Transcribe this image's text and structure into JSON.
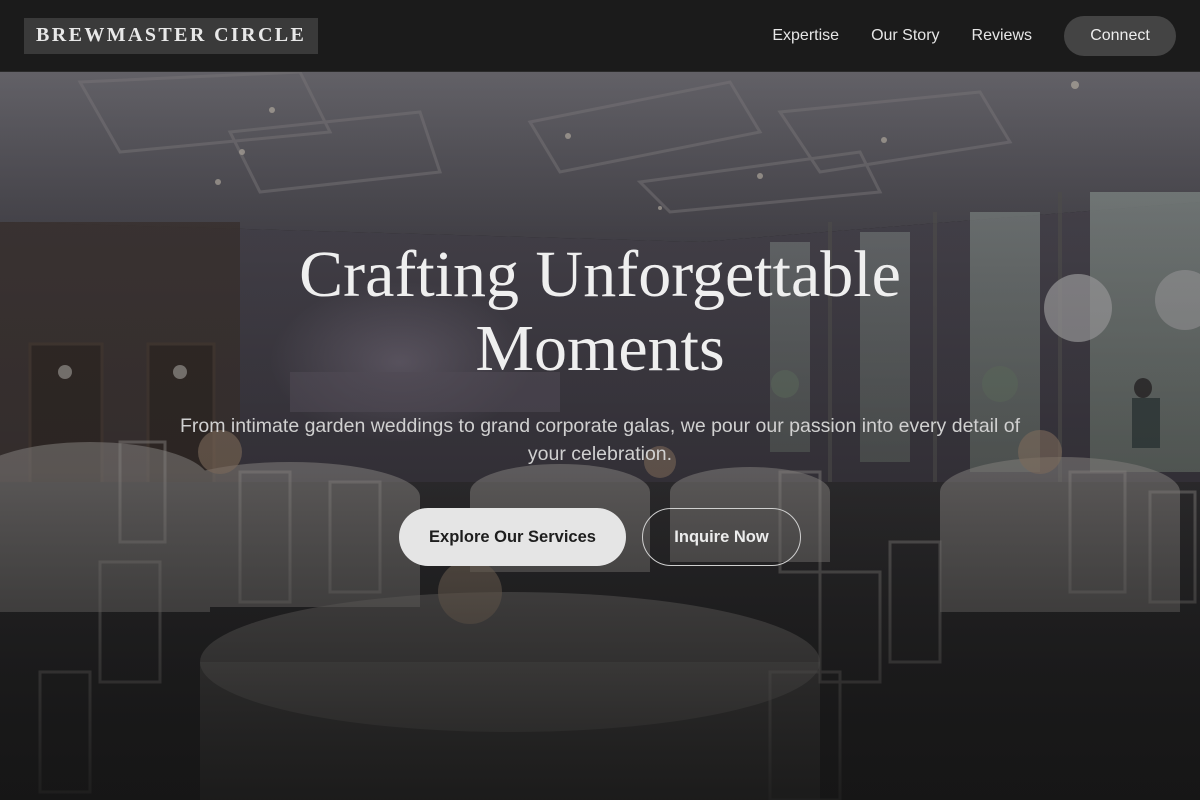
{
  "nav": {
    "logo_text": "BREWMASTER CIRCLE",
    "links": [
      "Expertise",
      "Our Story",
      "Reviews"
    ],
    "cta_label": "Connect"
  },
  "hero": {
    "title": "Crafting Unforgettable Moments",
    "subtitle": "From intimate garden weddings to grand corporate galas, we pour our passion into every detail of your celebration.",
    "primary_button": "Explore Our Services",
    "secondary_button": "Inquire Now",
    "background_image": "wedding-banquet-hall-photo"
  },
  "colors": {
    "nav_bg": "#1b1b1b",
    "logo_bg": "#3a3a3a",
    "button_primary_bg": "#e5e5e5",
    "button_dark_bg": "#444444"
  }
}
